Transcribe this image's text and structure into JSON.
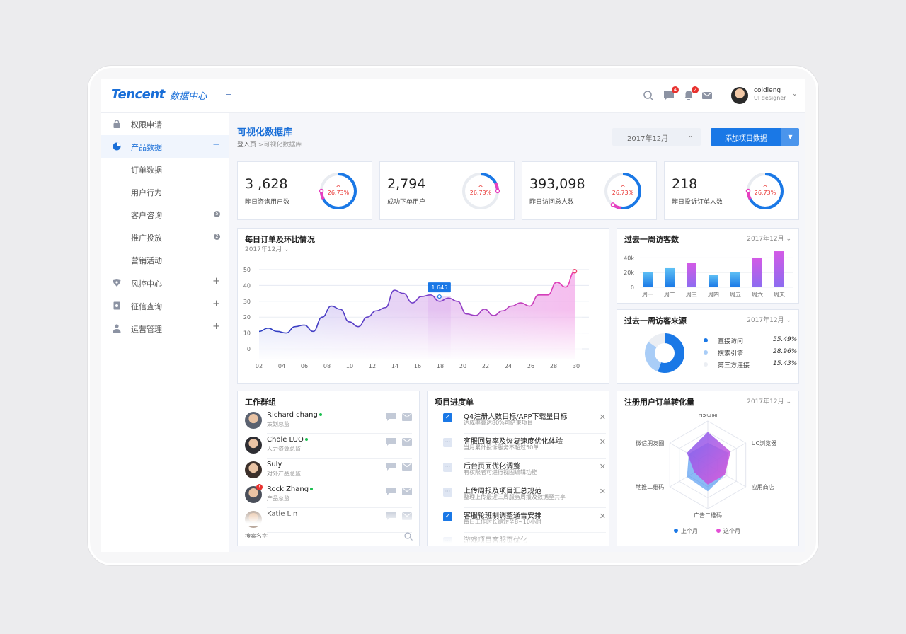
{
  "header": {
    "logo": "Tencent",
    "logo_sub": "数据中心",
    "icons": [
      "search-icon",
      "message-icon",
      "bell-icon",
      "mail-icon"
    ],
    "message_badge": "4",
    "bell_badge": "2",
    "user_name": "coldleng",
    "user_role": "UI designer"
  },
  "sidebar": {
    "items": [
      {
        "label": "权限申请",
        "icon": "lock-icon",
        "action": ""
      },
      {
        "label": "产品数据",
        "icon": "pie-chart-icon",
        "action": "−"
      },
      {
        "label": "订单数据",
        "icon": "",
        "action": ""
      },
      {
        "label": "用户行为",
        "icon": "",
        "action": ""
      },
      {
        "label": "客户咨询",
        "icon": "",
        "badge": "5"
      },
      {
        "label": "推广投放",
        "icon": "",
        "badge": "2"
      },
      {
        "label": "营销活动",
        "icon": "",
        "action": ""
      },
      {
        "label": "风控中心",
        "icon": "shield-icon",
        "action": "+"
      },
      {
        "label": "征信查询",
        "icon": "document-icon",
        "action": "+"
      },
      {
        "label": "运营管理",
        "icon": "user-icon",
        "action": "+"
      }
    ]
  },
  "main": {
    "title": "可视化数据库",
    "breadcrumb": [
      "登入页",
      ">可视化数据库"
    ],
    "date_select": "2017年12月",
    "add_button": "添加项目数据"
  },
  "kpis": [
    {
      "value": "3 ,628",
      "label": "昨日咨询用户数",
      "percent": "26.73%",
      "arrow": "^",
      "ring": 0.75
    },
    {
      "value": "2,794",
      "label": "成功下单用户",
      "percent": "26.73%",
      "arrow": "^",
      "ring": 0.25
    },
    {
      "value": "393,098",
      "label": "昨日访问总人数",
      "percent": "26.73%",
      "arrow": "^",
      "ring": 0.6
    },
    {
      "value": "218",
      "label": "昨日投诉订单人数",
      "percent": "26.73%",
      "arrow": "^",
      "ring": 0.75
    }
  ],
  "daily_orders": {
    "title": "每日订单及环比情况",
    "date": "2017年12月",
    "tooltip": "1.645"
  },
  "weekly_visitors": {
    "title": "过去一周访客数",
    "date": "2017年12月"
  },
  "visitor_sources": {
    "title": "过去一周访客来源",
    "date": "2017年12月",
    "items": [
      {
        "name": "直接访问",
        "pct": "55.49%",
        "color": "#1a78e6"
      },
      {
        "name": "搜索引擎",
        "pct": "28.96%",
        "color": "#a9cdf7"
      },
      {
        "name": "第三方连接",
        "pct": "15.43%",
        "color": "#ebeef3"
      }
    ]
  },
  "work_group": {
    "title": "工作群组",
    "search_placeholder": "搜索名字",
    "members": [
      {
        "name": "Richard chang",
        "role": "策划总监",
        "online": true,
        "badge": ""
      },
      {
        "name": "Chole LUO",
        "role": "人力资源总监",
        "online": true,
        "badge": ""
      },
      {
        "name": "Suly",
        "role": "对外产品总监",
        "online": false,
        "badge": ""
      },
      {
        "name": "Rock Zhang",
        "role": "产品总监",
        "online": true,
        "badge": "!"
      },
      {
        "name": "Katie Lin",
        "role": "",
        "online": false,
        "badge": ""
      }
    ]
  },
  "projects": {
    "title": "项目进度单",
    "tasks": [
      {
        "title": "Q4注册人数目标/APP下载量目标",
        "desc": "达成率高达80%可结束项目",
        "done": true
      },
      {
        "title": "客服回复率及恢复速度优化体验",
        "desc": "当月累计投诉服务不超过50单",
        "done": false
      },
      {
        "title": "后台页面优化调整",
        "desc": "有权限者可进行视图编辑功能",
        "done": false
      },
      {
        "title": "上传周报及项目汇总规范",
        "desc": "整理上传最近三周服务周报及数据至共享",
        "done": false
      },
      {
        "title": "客服轮班制调整通告安排",
        "desc": "每日工作时长缩短至8~10小时",
        "done": true
      },
      {
        "title": "游戏项目客服页优化",
        "desc": "",
        "done": false
      }
    ]
  },
  "conversion": {
    "title": "注册用户订单转化量",
    "date": "2017年12月",
    "axes": [
      "H5页面",
      "UC浏览器",
      "应用商店",
      "广告二维码",
      "地推二维码",
      "微信朋友圈"
    ],
    "legend": [
      "上个月",
      "这个月"
    ]
  },
  "chart_data": [
    {
      "type": "area",
      "title": "每日订单及环比情况",
      "x": [
        "02",
        "04",
        "06",
        "08",
        "10",
        "12",
        "14",
        "16",
        "18",
        "20",
        "22",
        "24",
        "26",
        "28",
        "30"
      ],
      "xlim": [
        1,
        30
      ],
      "ylim": [
        0,
        50
      ],
      "yticks": [
        0,
        10,
        20,
        30,
        40,
        50
      ],
      "series": [
        {
          "values": [
            [
              1,
              11
            ],
            [
              2,
              13
            ],
            [
              3,
              11
            ],
            [
              4,
              10
            ],
            [
              5,
              14
            ],
            [
              6,
              15
            ],
            [
              7,
              11
            ],
            [
              8,
              20
            ],
            [
              9,
              27
            ],
            [
              10,
              25
            ],
            [
              11,
              17
            ],
            [
              12,
              14
            ],
            [
              13,
              20
            ],
            [
              14,
              24
            ],
            [
              15,
              26
            ],
            [
              16,
              37
            ],
            [
              17,
              35
            ],
            [
              18,
              29
            ],
            [
              19,
              33
            ],
            [
              20,
              34
            ],
            [
              21,
              30
            ],
            [
              22,
              32
            ],
            [
              23,
              30
            ],
            [
              24,
              22
            ],
            [
              25,
              21
            ],
            [
              26,
              25
            ],
            [
              27,
              21
            ],
            [
              28,
              24
            ],
            [
              29,
              27
            ],
            [
              30,
              29
            ],
            [
              31,
              27
            ],
            [
              32,
              34
            ],
            [
              33,
              34
            ],
            [
              34,
              42
            ],
            [
              35,
              39
            ],
            [
              36,
              49
            ]
          ]
        }
      ],
      "highlight": {
        "tooltip": "1.645"
      },
      "grid": true
    },
    {
      "type": "bar",
      "title": "过去一周访客数",
      "categories": [
        "周一",
        "周二",
        "周三",
        "周四",
        "周五",
        "周六",
        "周天"
      ],
      "values": [
        21000,
        26000,
        33000,
        17000,
        21000,
        40000,
        49000
      ],
      "yticks": [
        "0",
        "20k",
        "40k"
      ],
      "ylim": [
        0,
        50000
      ]
    },
    {
      "type": "pie",
      "title": "过去一周访客来源",
      "labels": [
        "直接访问",
        "搜索引擎",
        "第三方连接"
      ],
      "values": [
        55.49,
        28.96,
        15.43
      ]
    },
    {
      "type": "radar",
      "title": "注册用户订单转化量",
      "axes": [
        "H5页面",
        "UC浏览器",
        "应用商店",
        "广告二维码",
        "地推二维码",
        "微信朋友圈"
      ],
      "series": [
        {
          "name": "上个月",
          "values": [
            0.5,
            0.55,
            0.45,
            0.6,
            0.55,
            0.5
          ],
          "color": "#3d8ef0"
        },
        {
          "name": "这个月",
          "values": [
            0.75,
            0.6,
            0.45,
            0.45,
            0.35,
            0.55
          ],
          "color": "#e44fd6"
        }
      ],
      "rmax": 1
    }
  ]
}
